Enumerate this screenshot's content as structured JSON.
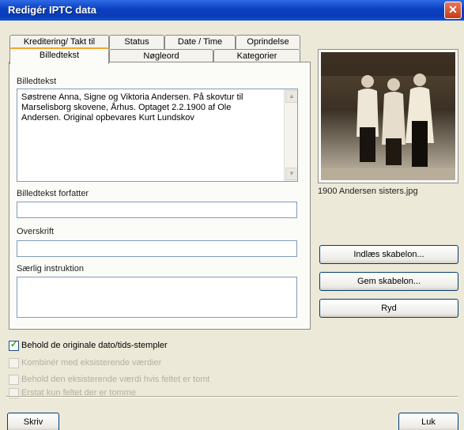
{
  "window": {
    "title": "Redigér IPTC data",
    "close_glyph": "✕"
  },
  "tabs": {
    "row1": [
      "Kreditering/ Takt til",
      "Status",
      "Date / Time",
      "Oprindelse"
    ],
    "row2": [
      "Billedtekst",
      "Nøgleord",
      "Kategorier"
    ]
  },
  "panel": {
    "caption_label": "Billedtekst",
    "caption_text": "Søstrene Anna, Signe og Viktoria Andersen. På skovtur til Marselisborg skovene, Århus. Optaget 2.2.1900 af Ole Andersen. Original opbevares Kurt Lundskov",
    "caption_writer_label": "Billedtekst forfatter",
    "caption_writer_value": "",
    "headline_label": "Overskrift",
    "headline_value": "",
    "instructions_label": "Særlig instruktion",
    "instructions_value": ""
  },
  "preview": {
    "filename": "1900 Andersen sisters.jpg"
  },
  "buttons": {
    "load_template": "Indlæs skabelon...",
    "save_template": "Gem skabelon...",
    "clear": "Ryd",
    "save": "Skriv",
    "close": "Luk"
  },
  "options": [
    {
      "label": "Behold de originale dato/tids-stempler",
      "checked": true,
      "enabled": true
    },
    {
      "label": "Kombinér med eksisterende værdier",
      "checked": false,
      "enabled": false
    },
    {
      "label": "Behold den eksisterende værdi hvis feltet er tomt",
      "checked": false,
      "enabled": false
    },
    {
      "label": "Erstat kun feltet der er tomme",
      "checked": false,
      "enabled": false
    }
  ],
  "colors": {
    "accent_tab": "#F7A52D",
    "titlebar": "#0A3CB8",
    "check_mark": "#21A121"
  }
}
